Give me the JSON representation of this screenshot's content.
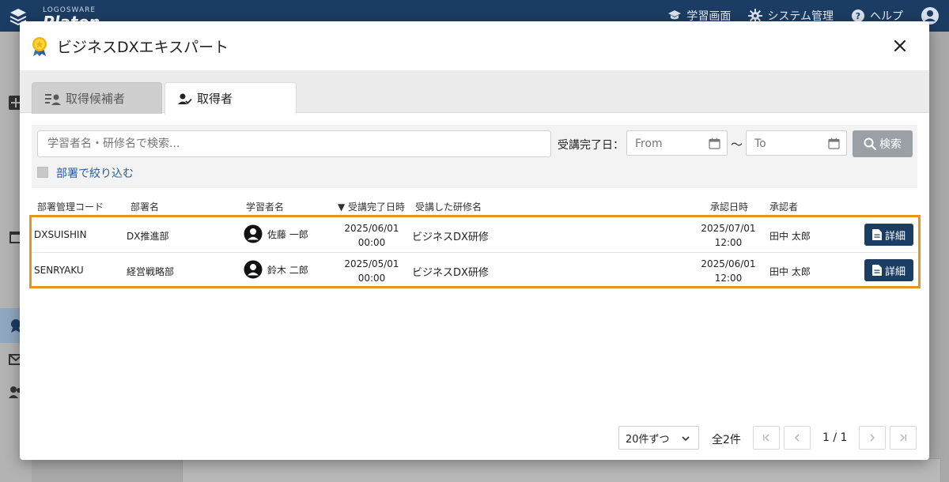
{
  "app": {
    "logo_small": "LOGOSWARE",
    "logo_big": "Platon",
    "nav": {
      "learning": "学習画面",
      "system": "システム管理",
      "help": "ヘルプ"
    }
  },
  "modal": {
    "title": "ビジネスDXエキスパート",
    "tabs": [
      {
        "label": "取得候補者"
      },
      {
        "label": "取得者"
      }
    ],
    "search": {
      "placeholder": "学習者名・研修名で検索...",
      "date_label": "受講完了日：",
      "from_placeholder": "From",
      "to_placeholder": "To",
      "tilde": "～",
      "search_button": "検索",
      "dept_filter_label": "部署で絞り込む"
    },
    "table": {
      "headers": {
        "code": "部署管理コード",
        "dept": "部署名",
        "learner": "学習者名",
        "completed": "▼ 受講完了日時",
        "course": "受講した研修名",
        "approved": "承認日時",
        "approver": "承認者"
      },
      "rows": [
        {
          "code": "DXSUISHIN",
          "dept": "DX推進部",
          "learner": "佐藤 一郎",
          "completed_date": "2025/06/01",
          "completed_time": "00:00",
          "course": "ビジネスDX研修",
          "approved_date": "2025/07/01",
          "approved_time": "12:00",
          "approver": "田中 太郎",
          "detail": "詳細"
        },
        {
          "code": "SENRYAKU",
          "dept": "経営戦略部",
          "learner": "鈴木 二郎",
          "completed_date": "2025/05/01",
          "completed_time": "00:00",
          "course": "ビジネスDX研修",
          "approved_date": "2025/06/01",
          "approved_time": "12:00",
          "approver": "田中 太郎",
          "detail": "詳細"
        }
      ]
    },
    "pagination": {
      "per_page": "20件ずつ",
      "total": "全2件",
      "page": "1 / 1"
    }
  },
  "colors": {
    "header_bg": "#1c3d63",
    "highlight": "#e59420",
    "link": "#2a5b99",
    "button_dark": "#1c3d63"
  },
  "icons": [
    "award-icon",
    "close-icon",
    "candidates-icon",
    "acquirers-icon",
    "calendar-icon",
    "search-icon",
    "user-avatar-icon",
    "document-icon",
    "chevron-down-icon",
    "first-page-icon",
    "prev-page-icon",
    "next-page-icon",
    "last-page-icon"
  ]
}
